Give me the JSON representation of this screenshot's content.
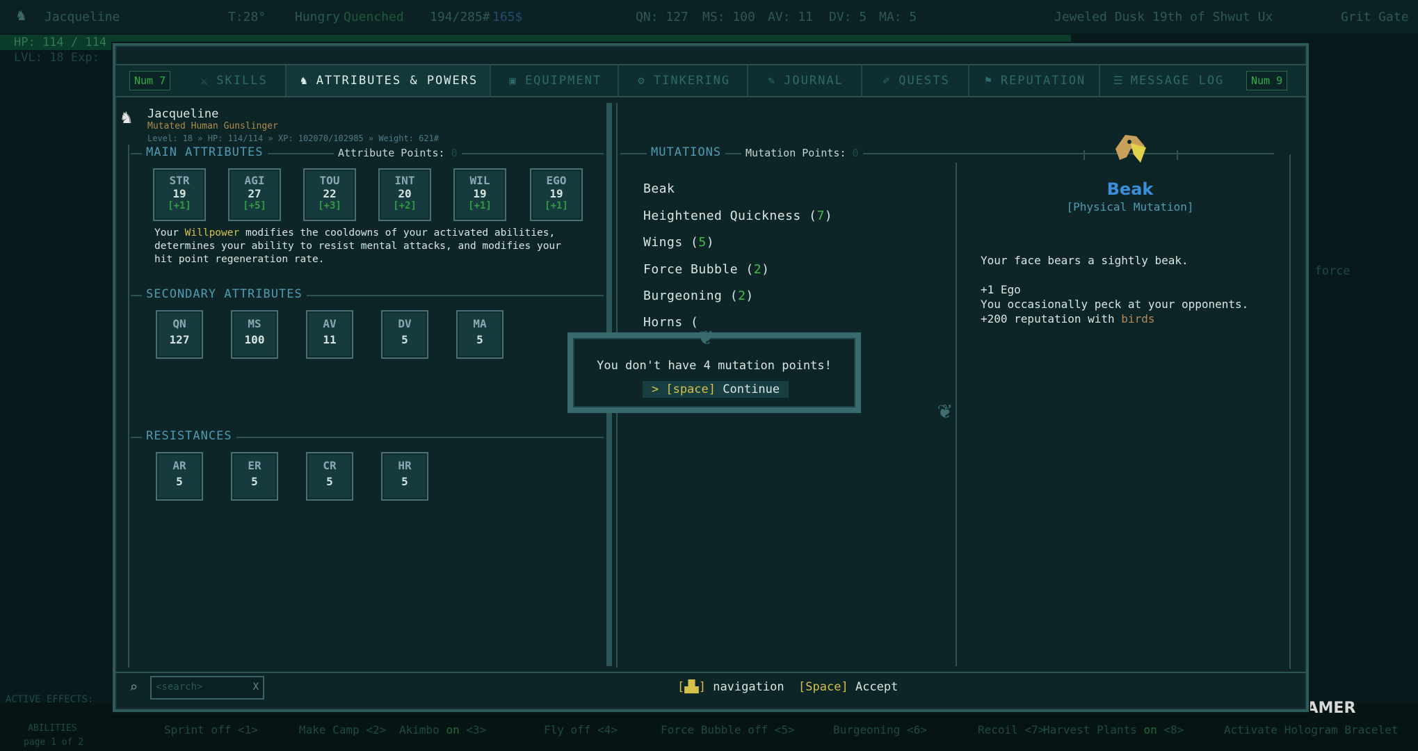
{
  "top_bar": {
    "name": "Jacqueline",
    "temp": "T:28°",
    "hunger": "Hungry",
    "thirst": "Quenched",
    "weight": "194/285#",
    "money": "165$",
    "qn": "QN: 127",
    "ms": "MS: 100",
    "av": "AV: 11",
    "dv": "DV: 5",
    "ma": "MA: 5",
    "date": "Jeweled Dusk 19th of Shwut Ux",
    "location": "Grit Gate"
  },
  "hp_bar": {
    "text": "HP: 114 / 114",
    "fraction": 1.0
  },
  "level_bar": {
    "text": "LVL: 18 Exp:"
  },
  "tabs": [
    {
      "label": "SKILLS",
      "icon": "skills-icon"
    },
    {
      "label": "ATTRIBUTES & POWERS",
      "icon": "character-icon",
      "active": true
    },
    {
      "label": "EQUIPMENT",
      "icon": "equipment-icon"
    },
    {
      "label": "TINKERING",
      "icon": "tinkering-icon"
    },
    {
      "label": "JOURNAL",
      "icon": "journal-icon"
    },
    {
      "label": "QUESTS",
      "icon": "quests-icon"
    },
    {
      "label": "REPUTATION",
      "icon": "reputation-icon"
    },
    {
      "label": "MESSAGE LOG",
      "icon": "message-log-icon"
    }
  ],
  "num_left": "Num 7",
  "num_right": "Num 9",
  "character": {
    "name": "Jacqueline",
    "subtitle": "Mutated Human Gunslinger",
    "stats_line": "Level: 18 » HP: 114/114 » XP: 102070/102985 » Weight: 621#"
  },
  "main_attributes": {
    "header": "MAIN ATTRIBUTES",
    "points_label": "Attribute Points:",
    "points_value": "0",
    "items": [
      {
        "label": "STR",
        "value": "19",
        "bonus": "[+1]"
      },
      {
        "label": "AGI",
        "value": "27",
        "bonus": "[+5]"
      },
      {
        "label": "TOU",
        "value": "22",
        "bonus": "[+3]"
      },
      {
        "label": "INT",
        "value": "20",
        "bonus": "[+2]"
      },
      {
        "label": "WIL",
        "value": "19",
        "bonus": "[+1]"
      },
      {
        "label": "EGO",
        "value": "19",
        "bonus": "[+1]"
      }
    ],
    "desc_prefix": "Your ",
    "desc_highlight": "Willpower",
    "desc_line1_rest": " modifies the cooldowns of your activated abilities,",
    "desc_line2": "determines your ability to resist mental attacks, and modifies your",
    "desc_line3": "hit point regeneration rate."
  },
  "secondary_attributes": {
    "header": "SECONDARY ATTRIBUTES",
    "items": [
      {
        "label": "QN",
        "value": "127",
        "color": "#d6e4e0"
      },
      {
        "label": "MS",
        "value": "100",
        "color": "#d6e4e0"
      },
      {
        "label": "AV",
        "value": "11",
        "color": "#3fbf4a"
      },
      {
        "label": "DV",
        "value": "5",
        "color": "#c8612c"
      },
      {
        "label": "MA",
        "value": "5",
        "color": "#d6e4e0"
      }
    ]
  },
  "resistances": {
    "header": "RESISTANCES",
    "items": [
      {
        "label": "AR",
        "value": "5"
      },
      {
        "label": "ER",
        "value": "5"
      },
      {
        "label": "CR",
        "value": "5"
      },
      {
        "label": "HR",
        "value": "5"
      }
    ]
  },
  "mutations": {
    "header": "MUTATIONS",
    "points_label": "Mutation Points:",
    "points_value": "0",
    "items": [
      {
        "name": "Beak",
        "level": ""
      },
      {
        "name": "Heightened Quickness",
        "level": "7"
      },
      {
        "name": "Wings",
        "level": "5"
      },
      {
        "name": "Force Bubble",
        "level": "2"
      },
      {
        "name": "Burgeoning",
        "level": "2"
      },
      {
        "name": "Horns",
        "level": ""
      }
    ]
  },
  "detail": {
    "title": "Beak",
    "type": "[Physical Mutation]",
    "line1": "Your face bears a sightly beak.",
    "line2": "+1 Ego",
    "line3": "You occasionally peck at your opponents.",
    "line4_prefix": "+200 reputation with ",
    "line4_highlight": "birds"
  },
  "modal": {
    "message": "You don't have 4 mutation points!",
    "key": "[space]",
    "action": "Continue"
  },
  "footer": {
    "search_placeholder": "<search>",
    "clear": "X",
    "nav_label": "navigation",
    "accept_key": "[Space]",
    "accept_label": "Accept"
  },
  "right_peek": {
    "text": "a force"
  },
  "ability_bar": {
    "active_effects": "ACTIVE EFFECTS:",
    "abilities_label": "ABILITIES",
    "page": "page 1 of 2",
    "items": [
      {
        "name": "Sprint",
        "state": "off",
        "key": "<1>"
      },
      {
        "name": "Make Camp",
        "state": "",
        "key": "<2>"
      },
      {
        "name": "Akimbo",
        "state": "on",
        "key": "<3>"
      },
      {
        "name": "Fly",
        "state": "off",
        "key": "<4>"
      },
      {
        "name": "Force Bubble",
        "state": "off",
        "key": "<5>"
      },
      {
        "name": "Burgeoning",
        "state": "",
        "key": "<6>"
      },
      {
        "name": "Recoil",
        "state": "",
        "key": "<7>"
      },
      {
        "name": "Harvest Plants",
        "state": "on",
        "key": "<8>"
      },
      {
        "name": "Activate Hologram Bracelet",
        "state": "",
        "key": ""
      }
    ]
  },
  "watermark": "THEGAMER"
}
